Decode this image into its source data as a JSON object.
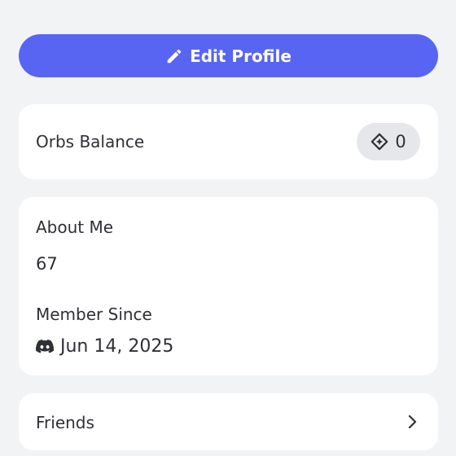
{
  "top_fragment": {
    "text": "· · · · · · ·"
  },
  "edit_profile": {
    "label": "Edit Profile",
    "icon": "pencil-icon"
  },
  "orbs": {
    "label": "Orbs Balance",
    "value": "0",
    "icon": "orb-icon"
  },
  "about": {
    "title": "About Me",
    "value": "67"
  },
  "member_since": {
    "title": "Member Since",
    "date": "Jun 14, 2025",
    "icon": "discord-icon"
  },
  "friends": {
    "label": "Friends",
    "icon": "chevron-right-icon"
  },
  "colors": {
    "accent": "#5865f2",
    "background": "#f2f3f5",
    "card": "#ffffff",
    "pill": "#e6e7ea",
    "text": "#2e3035"
  }
}
